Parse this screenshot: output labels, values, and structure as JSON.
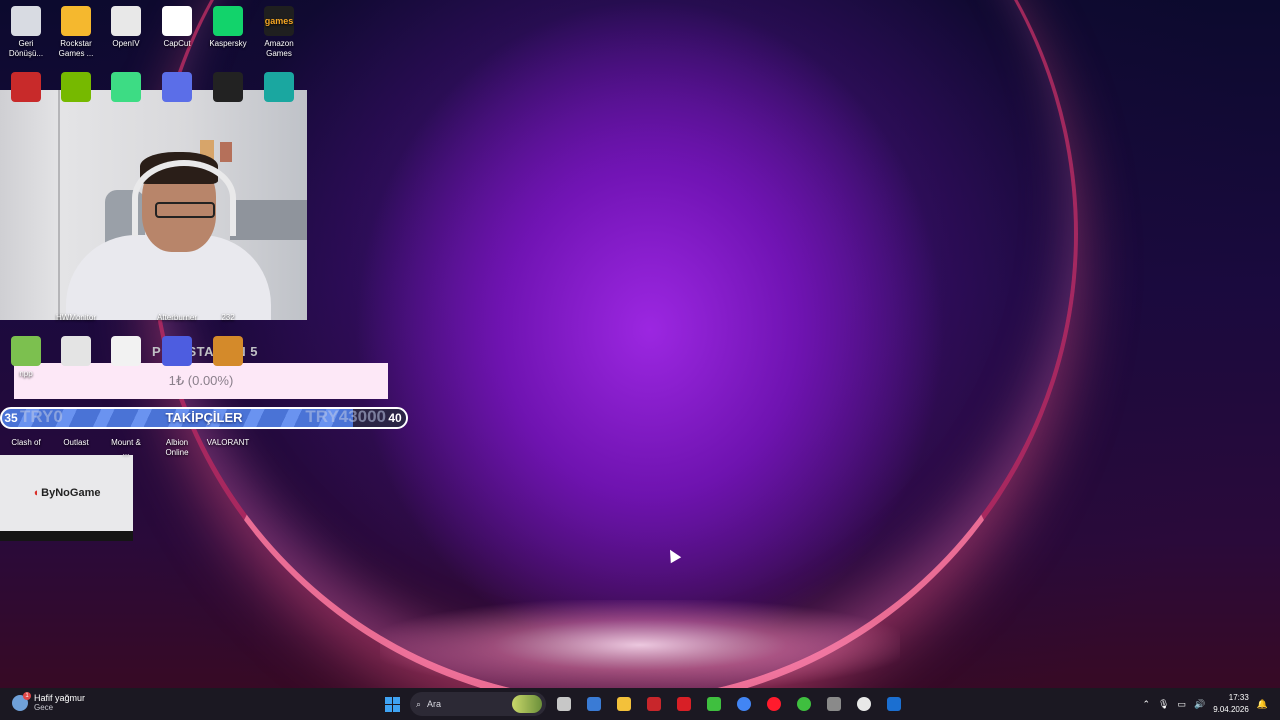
{
  "desktop_icons_row1": [
    {
      "label_l1": "Geri",
      "label_l2": "Dönüşü...",
      "icon": "recycle-bin-icon",
      "color": "#d8dbe2"
    },
    {
      "label_l1": "Rockstar",
      "label_l2": "Games ...",
      "icon": "rockstar-games-icon",
      "color": "#f5b82e"
    },
    {
      "label_l1": "OpenIV",
      "label_l2": "",
      "icon": "openiv-icon",
      "color": "#e8e8e8"
    },
    {
      "label_l1": "CapCut",
      "label_l2": "",
      "icon": "capcut-icon",
      "color": "#ffffff"
    },
    {
      "label_l1": "Kaspersky",
      "label_l2": "",
      "icon": "kaspersky-icon",
      "color": "#12d36b"
    },
    {
      "label_l1": "Amazon",
      "label_l2": "Games",
      "icon": "amazon-games-icon",
      "color": "#1f1f1f",
      "glyph": "games"
    }
  ],
  "desktop_icons_row2_partial": [
    {
      "icon": "app-icon-red",
      "color": "#c82a2a"
    },
    {
      "icon": "nvidia-icon",
      "color": "#76b900"
    },
    {
      "icon": "android-icon",
      "color": "#3ddc84"
    },
    {
      "icon": "app-icon-blue",
      "color": "#5b6ee8"
    },
    {
      "icon": "app-icon-dark",
      "color": "#222222"
    },
    {
      "icon": "app-icon-teal",
      "color": "#1aa7a0"
    }
  ],
  "desktop_partial_labels": {
    "afterburner": "Afterburner",
    "hwmonitor": "HWMonitor",
    "z32": "232"
  },
  "desktop_icons_row4": [
    {
      "label": "npp",
      "icon": "frog-icon",
      "color": "#7cc04f"
    },
    {
      "label": "",
      "icon": "truck-icon",
      "color": "#e4e4e4"
    },
    {
      "label": "",
      "icon": "java-icon",
      "color": "#f2f2f2"
    },
    {
      "label": "",
      "icon": "app-icon-blue2",
      "color": "#4d5de0"
    },
    {
      "label": "",
      "icon": "app-icon-orange",
      "color": "#d48a2a"
    }
  ],
  "desktop_icons_row5": [
    {
      "label_l1": "Clash of",
      "label_l2": "",
      "icon": "clash-icon"
    },
    {
      "label_l1": "Outlast",
      "label_l2": "",
      "icon": "outlast-icon"
    },
    {
      "label_l1": "Mount &",
      "label_l2": "...",
      "icon": "mount-blade-icon"
    },
    {
      "label_l1": "Albion",
      "label_l2": "Online",
      "icon": "albion-icon"
    },
    {
      "label_l1": "VALORANT",
      "label_l2": "",
      "icon": "valorant-icon"
    }
  ],
  "overlay": {
    "playstation_text": "PLAYSTATION 5",
    "donation_text": "1₺ (0.00%)",
    "followers": {
      "label": "TAKİPÇİLER",
      "start": "35",
      "end": "40",
      "ghost_left": "TRY0",
      "ghost_right": "TRY43000",
      "progress": 0.87
    },
    "sponsor": "ByNoGame"
  },
  "taskbar": {
    "weather_title": "Hafif yağmur",
    "weather_sub": "Gece",
    "weather_badge": "1",
    "search_placeholder": "Ara",
    "apps": [
      "file-explorer-icon",
      "store-icon",
      "folder-icon",
      "app-red-icon",
      "app-red2-icon",
      "minecraft-icon",
      "chrome-icon",
      "opera-icon",
      "discord-icon",
      "app-gray-icon",
      "obs-icon",
      "steam-icon"
    ],
    "time": "17:33",
    "date": "9.04.2026"
  },
  "colors": {
    "taskbar_bg": "#1b1822",
    "bar_blue": "#4a73d6",
    "donation_bg": "#fde8f7",
    "windows_blue": "#3fa3f3"
  }
}
